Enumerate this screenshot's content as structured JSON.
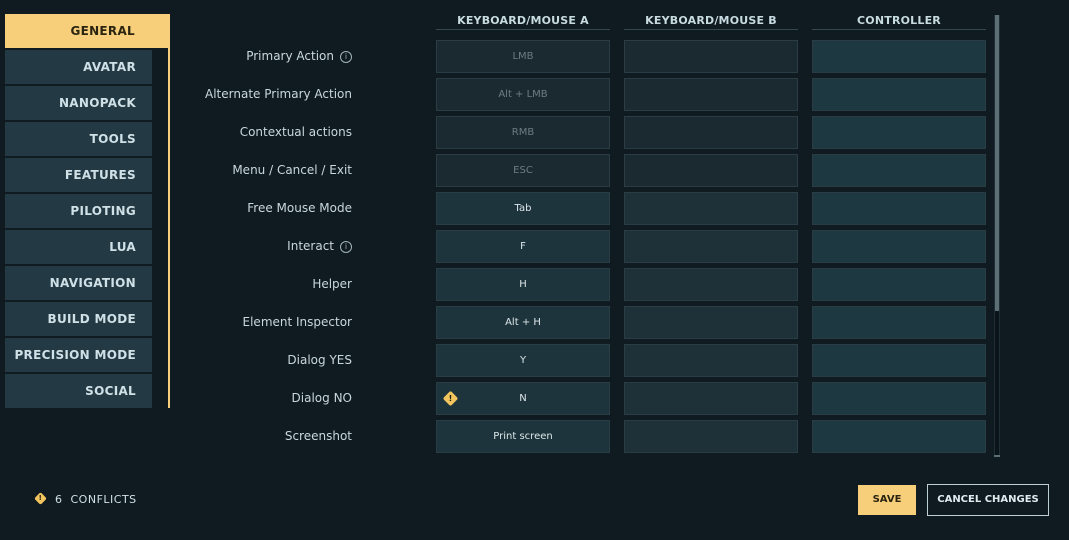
{
  "sidebar": {
    "items": [
      {
        "label": "GENERAL",
        "active": true
      },
      {
        "label": "AVATAR"
      },
      {
        "label": "NANOPACK"
      },
      {
        "label": "TOOLS"
      },
      {
        "label": "FEATURES"
      },
      {
        "label": "PILOTING"
      },
      {
        "label": "LUA"
      },
      {
        "label": "NAVIGATION"
      },
      {
        "label": "BUILD MODE"
      },
      {
        "label": "PRECISION MODE"
      },
      {
        "label": "SOCIAL"
      }
    ]
  },
  "columns": [
    "KEYBOARD/MOUSE A",
    "KEYBOARD/MOUSE B",
    "CONTROLLER"
  ],
  "rows": [
    {
      "label": "Primary Action",
      "info": true,
      "a": "LMB",
      "locked": true
    },
    {
      "label": "Alternate Primary Action",
      "a": "Alt + LMB",
      "locked": true
    },
    {
      "label": "Contextual actions",
      "a": "RMB",
      "locked": true
    },
    {
      "label": "Menu / Cancel / Exit",
      "a": "ESC",
      "locked": true
    },
    {
      "label": "Free Mouse Mode",
      "a": "Tab"
    },
    {
      "label": "Interact",
      "info": true,
      "a": "F"
    },
    {
      "label": "Helper",
      "a": "H"
    },
    {
      "label": "Element Inspector",
      "a": "Alt + H"
    },
    {
      "label": "Dialog YES",
      "a": "Y"
    },
    {
      "label": "Dialog NO",
      "a": "N",
      "conflict": true
    },
    {
      "label": "Screenshot",
      "a": "Print screen"
    }
  ],
  "icons": {
    "info": "info-icon",
    "conflict": "warning-icon"
  },
  "footer": {
    "conflicts_count": "6",
    "conflicts_label": "CONFLICTS",
    "save_label": "SAVE",
    "cancel_label": "CANCEL CHANGES"
  },
  "colors": {
    "accent": "#f7cf7b",
    "background": "#0f1b20",
    "panel": "#233a45",
    "warning": "#f2c45e"
  }
}
